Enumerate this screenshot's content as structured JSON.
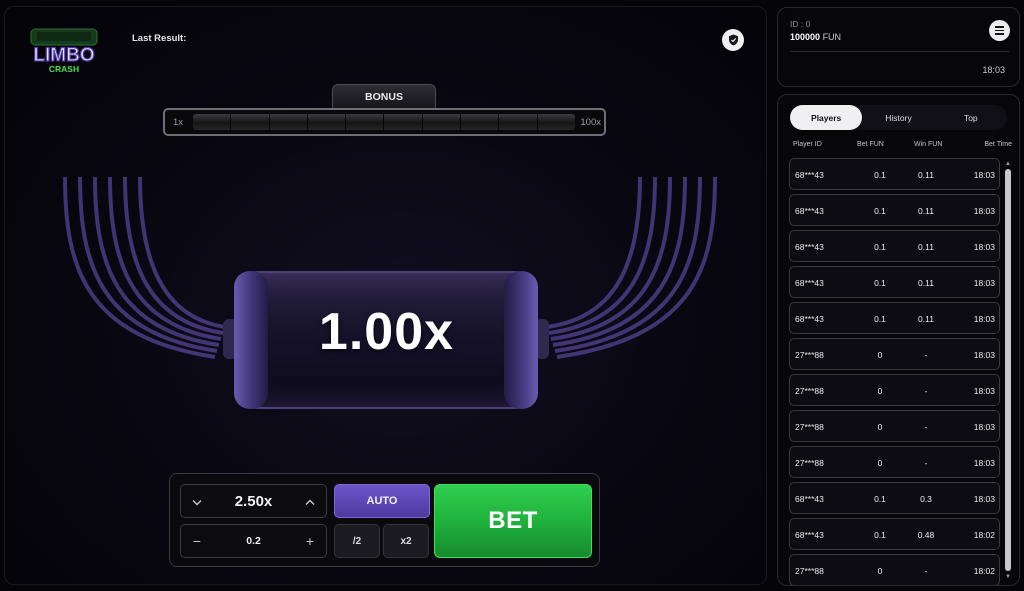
{
  "game": {
    "logo_line1": "LIMBO",
    "logo_line2": "CRASH",
    "last_result_label": "Last Result:",
    "bonus": {
      "label": "BONUS",
      "min": "1x",
      "max": "100x"
    },
    "multiplier_display": "1.00x"
  },
  "controls": {
    "target_multiplier": "2.50x",
    "bet_amount": "0.2",
    "auto_label": "AUTO",
    "half_label": "/2",
    "double_label": "x2",
    "bet_label": "BET"
  },
  "account": {
    "id_text": "ID : 0",
    "balance": "100000",
    "currency": "FUN",
    "time": "18:03"
  },
  "players_panel": {
    "tabs": [
      {
        "label": "Players",
        "active": true
      },
      {
        "label": "History",
        "active": false
      },
      {
        "label": "Top",
        "active": false
      }
    ],
    "headers": {
      "player_id": "Player ID",
      "bet": "Bet  FUN",
      "win": "Win  FUN",
      "time": "Bet Time"
    },
    "rows": [
      {
        "player": "68***43",
        "bet": "0.1",
        "win": "0.11",
        "time": "18:03"
      },
      {
        "player": "68***43",
        "bet": "0.1",
        "win": "0.11",
        "time": "18:03"
      },
      {
        "player": "68***43",
        "bet": "0.1",
        "win": "0.11",
        "time": "18:03"
      },
      {
        "player": "68***43",
        "bet": "0.1",
        "win": "0.11",
        "time": "18:03"
      },
      {
        "player": "68***43",
        "bet": "0.1",
        "win": "0.11",
        "time": "18:03"
      },
      {
        "player": "27***88",
        "bet": "0",
        "win": "-",
        "time": "18:03"
      },
      {
        "player": "27***88",
        "bet": "0",
        "win": "-",
        "time": "18:03"
      },
      {
        "player": "27***88",
        "bet": "0",
        "win": "-",
        "time": "18:03"
      },
      {
        "player": "27***88",
        "bet": "0",
        "win": "-",
        "time": "18:03"
      },
      {
        "player": "68***43",
        "bet": "0.1",
        "win": "0.3",
        "time": "18:03"
      },
      {
        "player": "68***43",
        "bet": "0.1",
        "win": "0.48",
        "time": "18:02"
      },
      {
        "player": "27***88",
        "bet": "0",
        "win": "-",
        "time": "18:02"
      }
    ]
  },
  "colors": {
    "accent_purple": "#5a45b4",
    "bet_green": "#22b540",
    "background": "#050409"
  },
  "icons": {
    "shield": "shield-icon",
    "menu": "hamburger-menu-icon",
    "chevron_down": "chevron-down-icon",
    "chevron_up": "chevron-up-icon",
    "minus": "minus-icon",
    "plus": "plus-icon"
  }
}
